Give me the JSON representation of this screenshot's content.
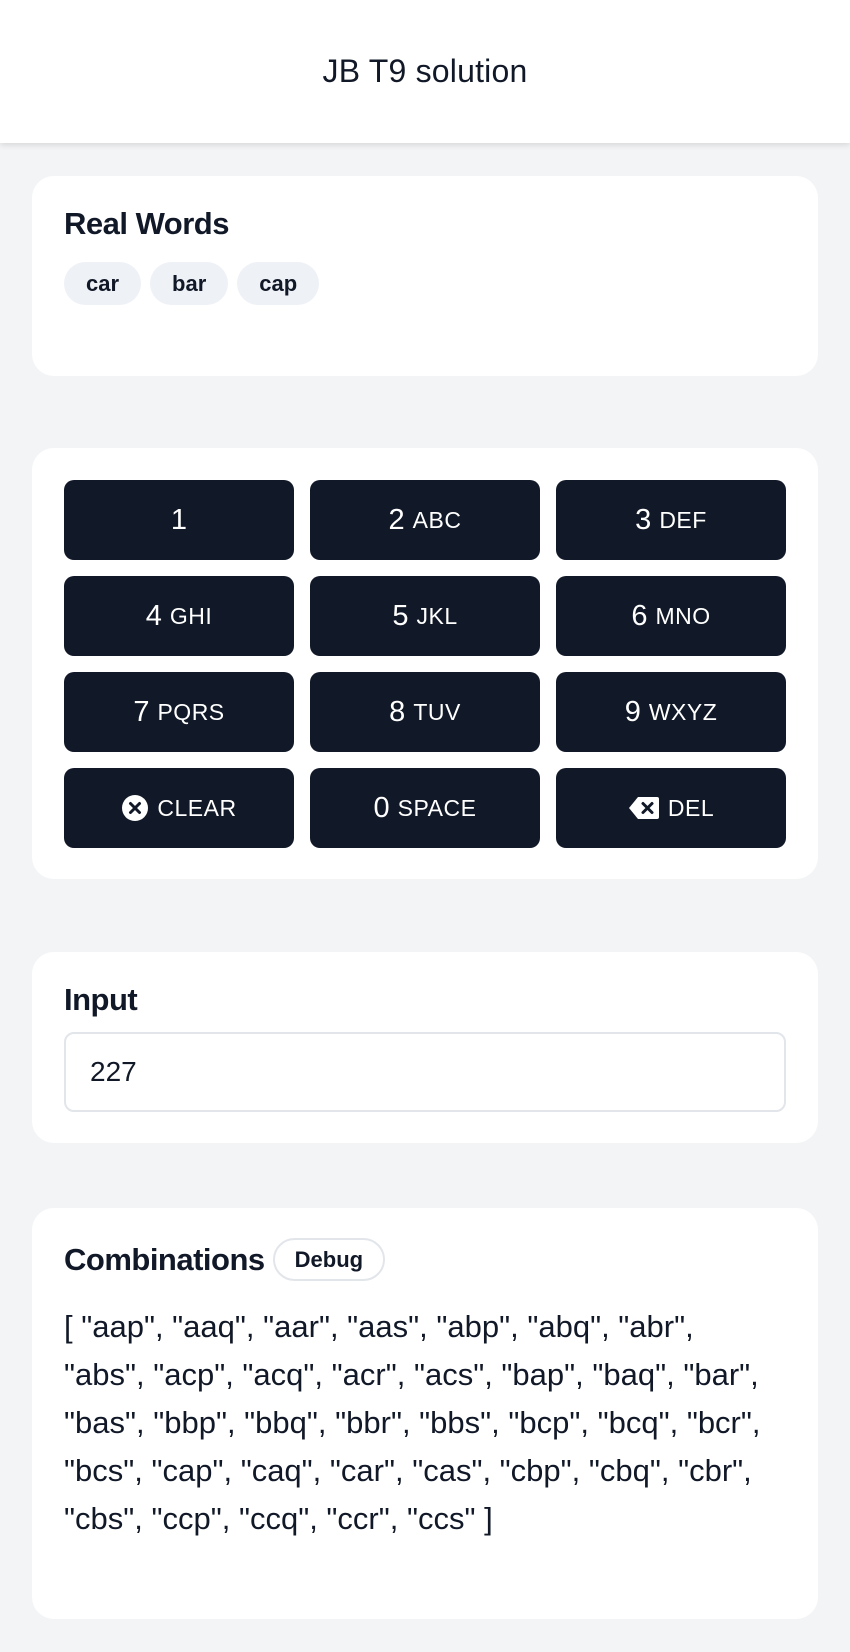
{
  "header": {
    "title": "JB T9 solution"
  },
  "real_words": {
    "title": "Real Words",
    "words": [
      "car",
      "bar",
      "cap"
    ]
  },
  "keypad": {
    "keys": [
      {
        "num": "1",
        "letters": ""
      },
      {
        "num": "2",
        "letters": "ABC"
      },
      {
        "num": "3",
        "letters": "DEF"
      },
      {
        "num": "4",
        "letters": "GHI"
      },
      {
        "num": "5",
        "letters": "JKL"
      },
      {
        "num": "6",
        "letters": "MNO"
      },
      {
        "num": "7",
        "letters": "PQRS"
      },
      {
        "num": "8",
        "letters": "TUV"
      },
      {
        "num": "9",
        "letters": "WXYZ"
      },
      {
        "num": "",
        "letters": "CLEAR",
        "icon": "clear-circle-icon"
      },
      {
        "num": "0",
        "letters": "SPACE"
      },
      {
        "num": "",
        "letters": "DEL",
        "icon": "backspace-icon"
      }
    ]
  },
  "input": {
    "title": "Input",
    "value": "227"
  },
  "combinations": {
    "title": "Combinations",
    "badge": "Debug",
    "text": "[ \"aap\", \"aaq\", \"aar\", \"aas\", \"abp\", \"abq\", \"abr\", \"abs\", \"acp\", \"acq\", \"acr\", \"acs\", \"bap\", \"baq\", \"bar\", \"bas\", \"bbp\", \"bbq\", \"bbr\", \"bbs\", \"bcp\", \"bcq\", \"bcr\", \"bcs\", \"cap\", \"caq\", \"car\", \"cas\", \"cbp\", \"cbq\", \"cbr\", \"cbs\", \"ccp\", \"ccq\", \"ccr\", \"ccs\" ]"
  },
  "colors": {
    "key_bg": "#111827",
    "page_bg": "#f3f4f6",
    "chip_bg": "#eef1f6"
  }
}
